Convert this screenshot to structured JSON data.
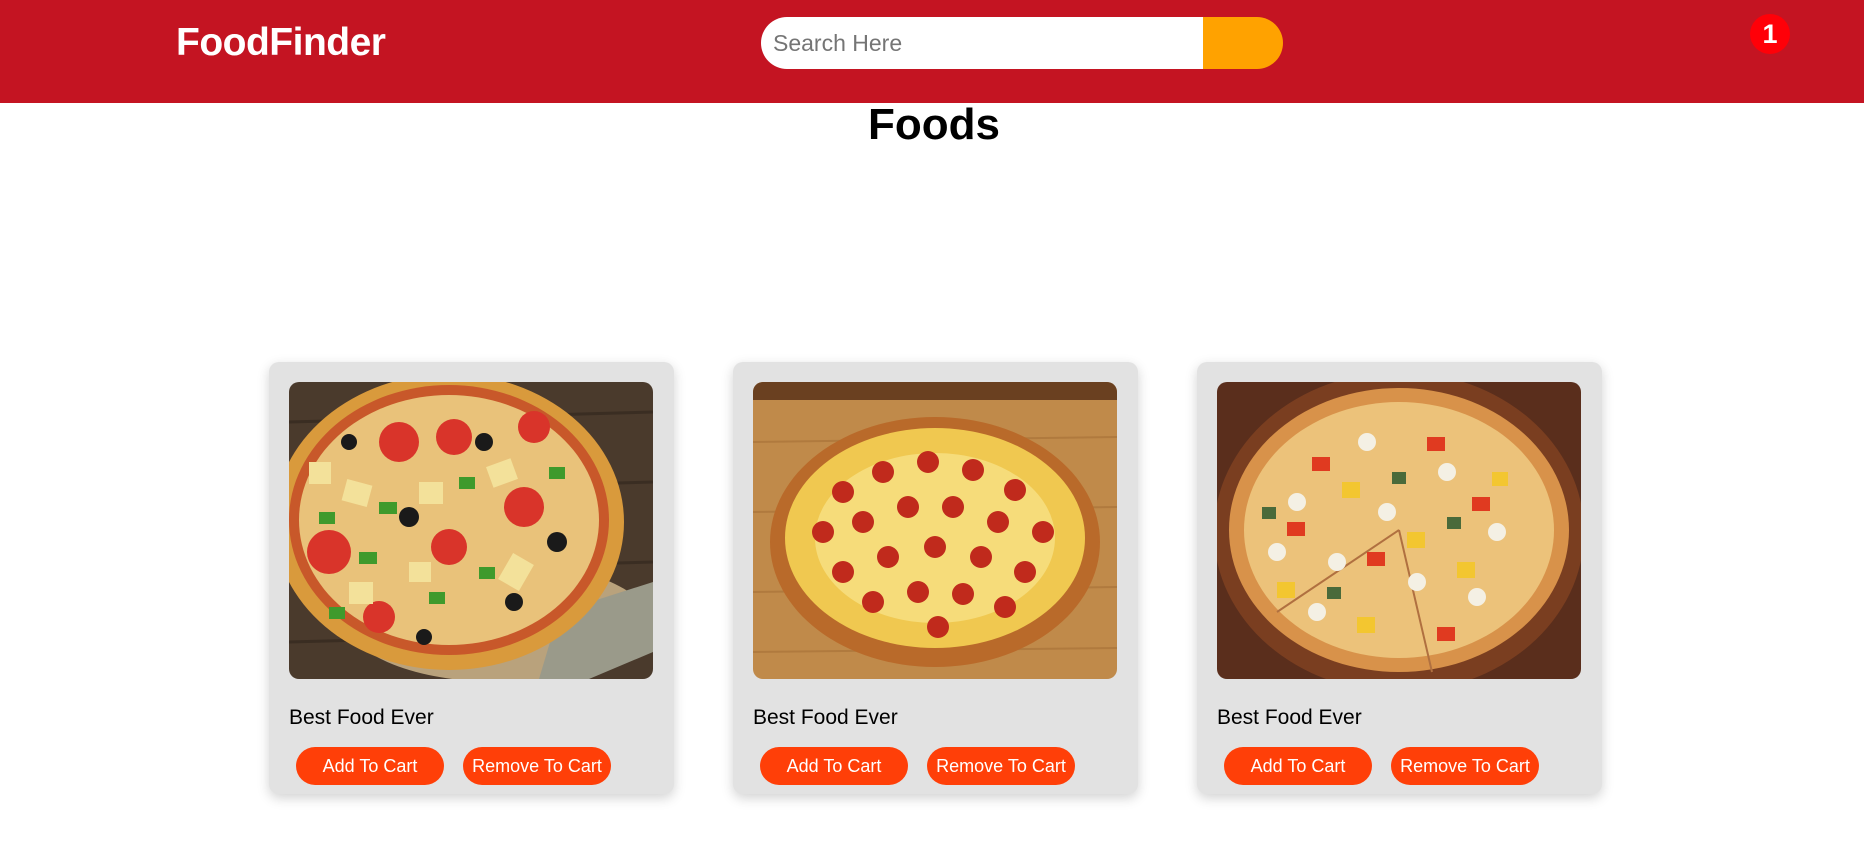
{
  "header": {
    "brand": "FoodFinder",
    "search": {
      "placeholder": "Search Here",
      "value": ""
    },
    "cart_count": "1"
  },
  "page": {
    "title": "Foods"
  },
  "cards": [
    {
      "title": "Best Food Ever",
      "image": "pizza-supreme-image",
      "add_label": "Add To Cart",
      "remove_label": "Remove To Cart"
    },
    {
      "title": "Best Food Ever",
      "image": "pizza-pepperoni-image",
      "add_label": "Add To Cart",
      "remove_label": "Remove To Cart"
    },
    {
      "title": "Best Food Ever",
      "image": "pizza-veggie-image",
      "add_label": "Add To Cart",
      "remove_label": "Remove To Cart"
    }
  ],
  "colors": {
    "navbar": "#c41422",
    "search_button": "#ffa200",
    "badge": "#ff0008",
    "button": "#ff3f08",
    "card": "#e2e2e2"
  }
}
